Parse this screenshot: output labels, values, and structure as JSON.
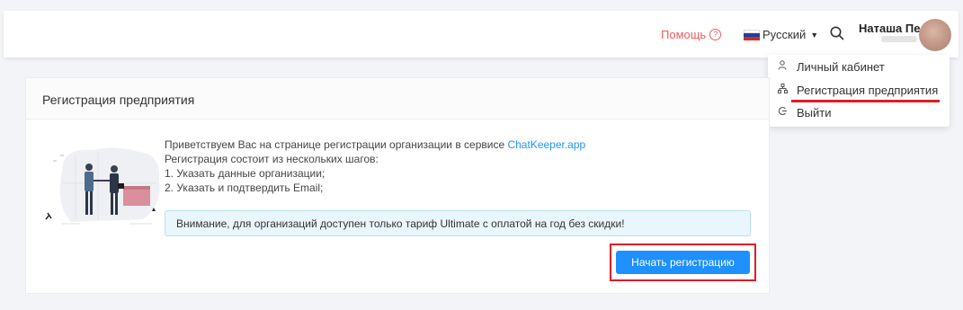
{
  "header": {
    "help_label": "Помощь",
    "language_label": "Русский",
    "user_name": "Наташа Пе"
  },
  "dropdown": {
    "items": [
      {
        "label": "Личный кабинет",
        "icon": "person-icon"
      },
      {
        "label": "Регистрация предприятия",
        "icon": "org-structure-icon"
      },
      {
        "label": "Выйти",
        "icon": "logout-icon"
      }
    ]
  },
  "card": {
    "title": "Регистрация предприятия",
    "greeting": "Приветствуем Вас на странице регистрации организации в сервисе ",
    "greeting_link": "ChatKeeper.app",
    "steps_intro": "Регистрация состоит из нескольких шагов:",
    "step1": "1. Указать данные организации;",
    "step2": "2. Указать и подтвердить Email;",
    "alert": "Внимание, для организаций доступен только тариф Ultimate с оплатой на год без скидки!",
    "start_button": "Начать регистрацию"
  },
  "colors": {
    "accent": "#1e90ff",
    "help": "#ef5b5b",
    "highlight": "#e01b24",
    "alert_bg": "#e9f6fc"
  }
}
